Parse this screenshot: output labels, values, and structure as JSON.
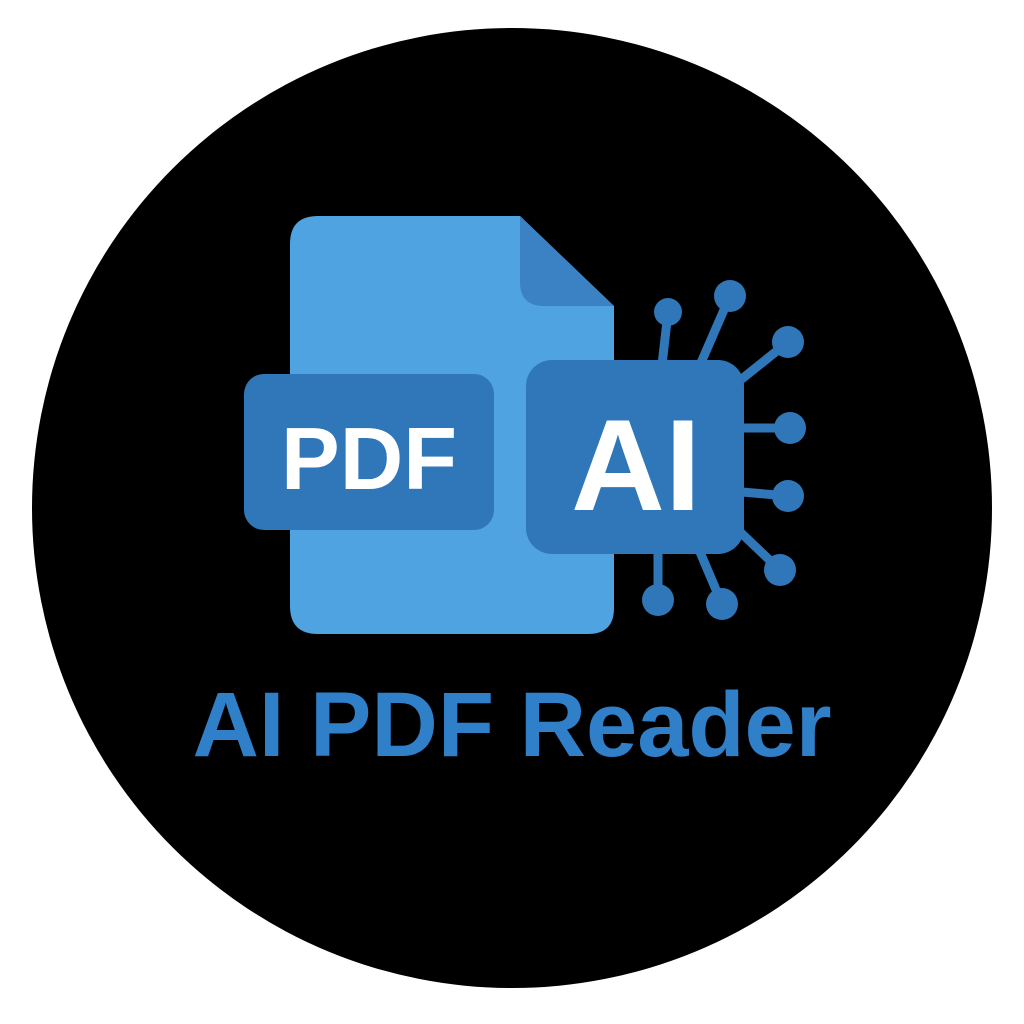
{
  "logo": {
    "document_badge_text": "PDF",
    "chip_text": "AI",
    "title": "AI PDF Reader"
  },
  "colors": {
    "background": "#000000",
    "page": "#ffffff",
    "document_light": "#4ea3e0",
    "document_fold": "#3a82c4",
    "badge": "#2f77b8",
    "accent_text": "#2f7fc9",
    "white_text": "#ffffff"
  },
  "icons": [
    "document-icon",
    "circuit-chip-icon"
  ]
}
